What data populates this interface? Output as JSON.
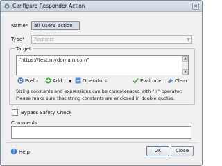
{
  "window": {
    "title": "Configure Responder Action",
    "close_glyph": "✕"
  },
  "form": {
    "name_label": "Name*",
    "name_value": "all_users_action",
    "type_label": "Type*",
    "type_value": "Redirect"
  },
  "target": {
    "legend": "Target",
    "expression": "\"https://test.mydomain.com\"",
    "toolbar": {
      "prefix": "Prefix",
      "add": "Add...",
      "operators": "Operators",
      "evaluate": "Evaluate...",
      "clear": "Clear"
    },
    "hint_line1": "String constants and expressions can be concatenated with \"+\" operator.",
    "hint_line2": "Please make sure that string constants are enclosed in double quotes."
  },
  "bypass_label": "Bypass Safety Check",
  "comments_label": "Comments",
  "footer": {
    "help": "Help",
    "ok": "OK",
    "close": "Close"
  },
  "icons": {
    "title": "gear-icon",
    "prefix": "prefix-icon",
    "add": "plus-icon",
    "operators": "operators-icon",
    "evaluate": "check-icon",
    "clear": "eraser-icon",
    "help": "help-icon"
  }
}
